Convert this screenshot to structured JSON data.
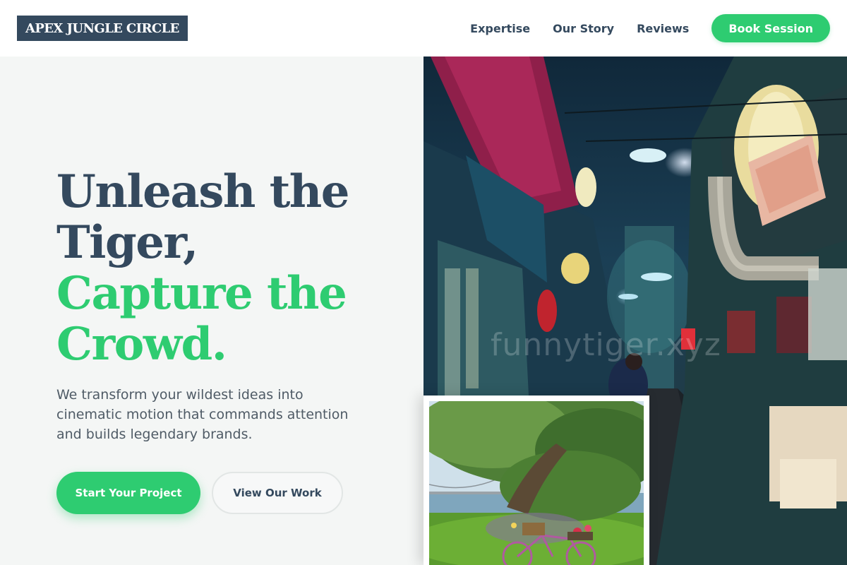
{
  "brand": {
    "name": "APEX JUNGLE CIRCLE"
  },
  "nav": {
    "links": [
      "Expertise",
      "Our Story",
      "Reviews"
    ],
    "cta": "Book Session"
  },
  "hero": {
    "headline_lines": [
      "Unleash the",
      "Tiger,"
    ],
    "headline_accent_lines": [
      "Capture the",
      "Crowd."
    ],
    "subtext": "We transform your wildest ideas into cinematic motion that commands attention and builds legendary brands.",
    "primary_cta": "Start Your Project",
    "secondary_cta": "View Our Work"
  },
  "media": {
    "main_image_watermark": "funnytiger.xyz"
  },
  "colors": {
    "primary_dark": "#34495e",
    "accent_green": "#2ecc71",
    "hero_bg": "#f4f6f5"
  }
}
